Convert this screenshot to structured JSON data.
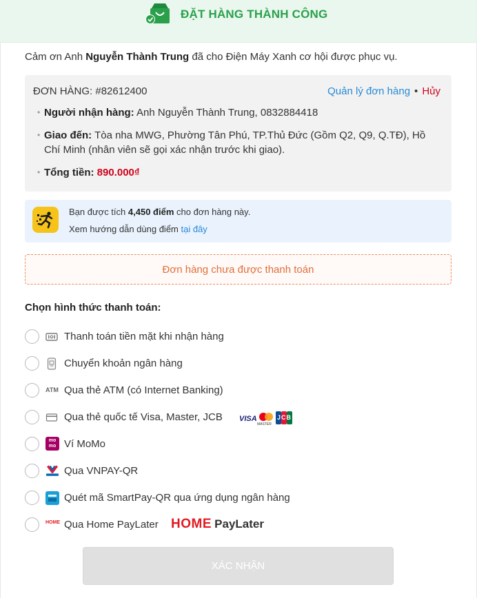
{
  "header": {
    "title": "ĐẶT HÀNG THÀNH CÔNG",
    "icon": "shopping-bag-check-icon",
    "accent": "#2ba04b"
  },
  "thanks": {
    "prefix": "Cảm ơn Anh ",
    "customer": "Nguyễn Thành Trung",
    "suffix": " đã cho Điện Máy Xanh cơ hội được phục vụ."
  },
  "order": {
    "code": "ĐƠN HÀNG: #82612400",
    "manage_label": "Quản lý đơn hàng",
    "separator": "•",
    "cancel_label": "Hủy",
    "receiver_label": "Người nhận hàng:",
    "receiver_value": " Anh Nguyễn Thành Trung, 0832884418",
    "delivery_label": "Giao đến:",
    "delivery_value": " Tòa nha MWG, Phường Tân Phú, TP.Thủ Đức (Gồm Q2, Q9, Q.TĐ), Hồ Chí Minh (nhân viên sẽ gọi xác nhận trước khi giao).",
    "total_label": "Tổng tiền:",
    "total_value": "890.000₫"
  },
  "points": {
    "prefix": "Bạn được tích ",
    "amount": "4,450 điểm",
    "suffix": " cho đơn hàng này.",
    "guide_prefix": "Xem hướng dẫn dùng điểm ",
    "guide_link": "tại đây"
  },
  "unpaid_notice": "Đơn hàng chưa được thanh toán",
  "payment": {
    "title": "Chọn hình thức thanh toán:",
    "options": [
      {
        "label": "Thanh toán tiền mặt khi nhận hàng",
        "icon": "cash-icon"
      },
      {
        "label": "Chuyển khoản ngân hàng",
        "icon": "bank-transfer-icon"
      },
      {
        "label": "Qua thẻ ATM (có Internet Banking)",
        "icon": "atm-icon"
      },
      {
        "label": "Qua thẻ quốc tế Visa, Master, JCB",
        "icon": "credit-card-icon"
      },
      {
        "label": "Ví MoMo",
        "icon": "momo-icon"
      },
      {
        "label": "Qua VNPAY-QR",
        "icon": "vnpay-icon"
      },
      {
        "label": "Quét mã SmartPay-QR qua ứng dụng ngân hàng",
        "icon": "smartpay-icon"
      },
      {
        "label": "Qua Home PayLater",
        "icon": "home-paylater-icon"
      }
    ],
    "card_brands": {
      "visa": "VISA",
      "master": "MASTER",
      "jcb": "JCB"
    },
    "momo_text": "mo mo",
    "atm_text": "ATM",
    "home_logo_a": "HOME",
    "home_logo_b": "PayLater",
    "home_mini": "HOME"
  },
  "confirm_label": "XÁC NHẬN",
  "colors": {
    "price": "#d0021b",
    "link": "#288ad6",
    "notice": "#e06e3b",
    "momo": "#a50064",
    "homeRed": "#e11b22"
  }
}
